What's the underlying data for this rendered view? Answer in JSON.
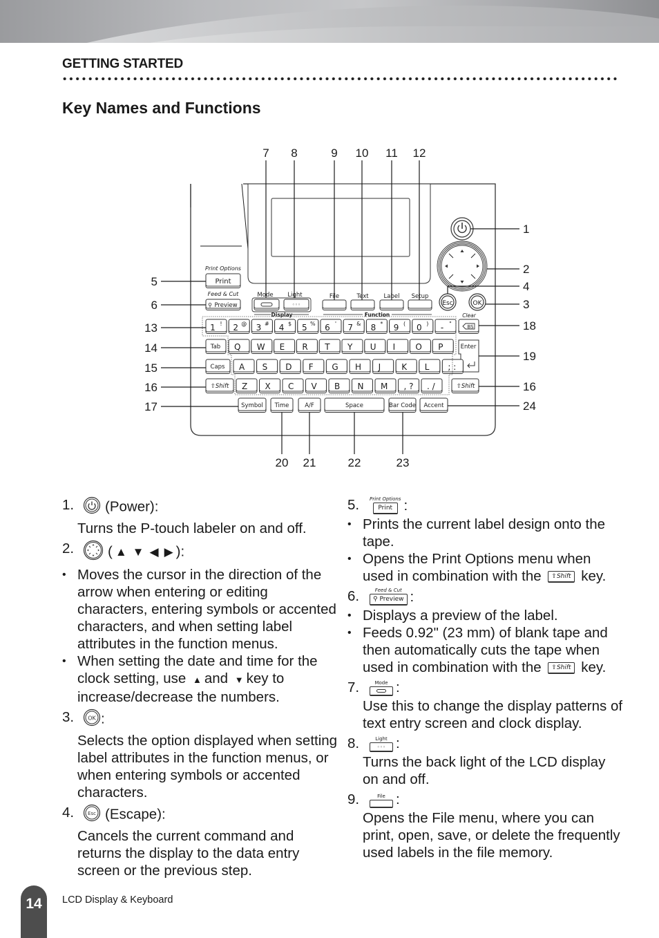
{
  "header": {
    "section": "GETTING STARTED",
    "title": "Key Names and Functions"
  },
  "diagram": {
    "callouts_top": [
      "7",
      "8",
      "9",
      "10",
      "11",
      "12"
    ],
    "callouts_left": [
      "5",
      "6",
      "13",
      "14",
      "15",
      "16",
      "17"
    ],
    "callouts_right": [
      "1",
      "2",
      "4",
      "3",
      "18",
      "19",
      "16",
      "24"
    ],
    "callouts_bottom": [
      "20",
      "21",
      "22",
      "23"
    ],
    "labels": {
      "print_options": "Print Options",
      "print": "Print",
      "feed_cut": "Feed & Cut",
      "preview": "Preview",
      "mode": "Mode",
      "light": "Light",
      "display": "Display",
      "file": "File",
      "text": "Text",
      "label": "Label",
      "setup": "Setup",
      "function": "Function",
      "esc": "Esc",
      "ok": "OK",
      "clear": "Clear",
      "bs": "BS",
      "tab": "Tab",
      "caps": "Caps",
      "shift": "Shift",
      "enter": "Enter",
      "symbol": "Symbol",
      "time": "Time",
      "af": "A/F",
      "space": "Space",
      "barcode": "Bar Code",
      "accent": "Accent"
    },
    "number_row": [
      [
        "1",
        "!"
      ],
      [
        "2",
        "@"
      ],
      [
        "3",
        "#"
      ],
      [
        "4",
        "$"
      ],
      [
        "5",
        "%"
      ],
      [
        "6",
        "'"
      ],
      [
        "7",
        "&"
      ],
      [
        "8",
        "*"
      ],
      [
        "9",
        "("
      ],
      [
        "0",
        ")"
      ],
      [
        "-",
        "\""
      ]
    ],
    "qwerty_row": [
      "Q",
      "W",
      "E",
      "R",
      "T",
      "Y",
      "U",
      "I",
      "O",
      "P"
    ],
    "asdf_row": [
      "A",
      "S",
      "D",
      "F",
      "G",
      "H",
      "J",
      "K",
      "L",
      "; :"
    ],
    "zxcv_row": [
      "Z",
      "X",
      "C",
      "V",
      "B",
      "N",
      "M",
      ", ?",
      ". /"
    ]
  },
  "left_column": {
    "items": [
      {
        "num": "1.",
        "icon": "power-icon",
        "suffix": "(Power):",
        "desc": "Turns the P-touch labeler on and off."
      },
      {
        "num": "2.",
        "icon": "cursor-pad-icon",
        "suffix_open": "(",
        "suffix_close": "):",
        "bullets": [
          "Moves the cursor in the direction of the arrow when entering or editing characters, entering symbols or accented characters, and when setting label attributes in the function menus.",
          {
            "pre": "When setting the date and time for the clock setting, use",
            "mid": "and",
            "post": "key to increase/decrease the numbers."
          }
        ]
      },
      {
        "num": "3.",
        "icon": "ok-icon",
        "suffix": ":",
        "desc": "Selects the option displayed when setting label attributes in the function menus, or when entering symbols or accented characters."
      },
      {
        "num": "4.",
        "icon": "esc-icon",
        "suffix": "(Escape):",
        "desc": "Cancels the current command and returns the display to the data entry screen or the previous step."
      }
    ]
  },
  "right_column": {
    "items": [
      {
        "num": "5.",
        "cap_top": "Print Options",
        "cap": "Print",
        "suffix": ":",
        "bullets": [
          "Prints the current label design onto the tape.",
          {
            "pre": "Opens the Print Options menu when used in combination with the",
            "key": "Shift",
            "post": "key."
          }
        ]
      },
      {
        "num": "6.",
        "cap_top": "Feed & Cut",
        "cap": "Preview",
        "suffix": ":",
        "bullets": [
          "Displays a preview of the label.",
          {
            "pre": "Feeds 0.92\" (23 mm) of blank tape and then automatically cuts the tape when used in combination with the",
            "key": "Shift",
            "post": "key."
          }
        ]
      },
      {
        "num": "7.",
        "cap_top": "Mode",
        "suffix": ":",
        "desc": "Use this to change the display patterns of text entry screen and clock display."
      },
      {
        "num": "8.",
        "cap_top": "Light",
        "suffix": ":",
        "desc": "Turns the back light of the LCD display on and off."
      },
      {
        "num": "9.",
        "cap_top": "File",
        "suffix": ":",
        "desc": "Opens the File menu, where you can print, open, save, or delete the frequently used labels in the file memory."
      }
    ]
  },
  "footer": {
    "page_number": "14",
    "chapter": "LCD Display & Keyboard"
  }
}
